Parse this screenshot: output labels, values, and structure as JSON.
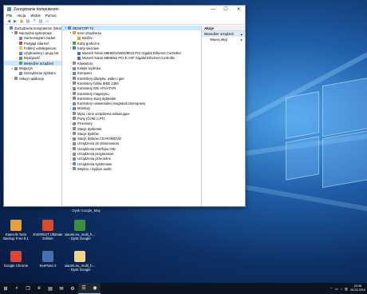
{
  "window": {
    "title": "Zarządzanie komputerem",
    "minimize": "—",
    "maximize": "☐",
    "close": "✕"
  },
  "menu": [
    "Plik",
    "Akcja",
    "Widok",
    "Pomoc"
  ],
  "left_tree": [
    {
      "label": "Zarządzanie komputerem (lokal",
      "indent": 0,
      "exp": "",
      "color": "#5a8ccc"
    },
    {
      "label": "Narzędzia systemowe",
      "indent": 1,
      "exp": "▾",
      "color": "#8a8a8a"
    },
    {
      "label": "Harmonogram zadań",
      "indent": 2,
      "exp": "›",
      "color": "#6d8fb8"
    },
    {
      "label": "Podgląd zdarzeń",
      "indent": 2,
      "exp": "›",
      "color": "#c0504d"
    },
    {
      "label": "Foldery udostępnione",
      "indent": 2,
      "exp": "›",
      "color": "#e8c05a"
    },
    {
      "label": "Użytkownicy i grupy lok",
      "indent": 2,
      "exp": "›",
      "color": "#5a8ccc"
    },
    {
      "label": "Wydajność",
      "indent": 2,
      "exp": "›",
      "color": "#4aa34a"
    },
    {
      "label": "Menedżer urządzeń",
      "indent": 2,
      "exp": "",
      "color": "#6a88b0",
      "selected": true
    },
    {
      "label": "Magazyn",
      "indent": 1,
      "exp": "▾",
      "color": "#8a8a8a"
    },
    {
      "label": "Zarządzanie dyskami",
      "indent": 2,
      "exp": "",
      "color": "#8a8a8a"
    },
    {
      "label": "Usługi i aplikacje",
      "indent": 1,
      "exp": "›",
      "color": "#8a8a8a"
    }
  ],
  "device_tree": [
    {
      "label": "DESKTOP-T2",
      "indent": 0,
      "exp": "▾",
      "color": "#5a8ccc",
      "selected": true
    },
    {
      "label": "Inne urządzenia",
      "indent": 1,
      "exp": "▾",
      "color": "#d9a23b"
    },
    {
      "label": "Bodźni",
      "indent": 2,
      "exp": "",
      "color": "#d9a23b"
    },
    {
      "label": "Karty graficzne",
      "indent": 1,
      "exp": "›",
      "color": "#4aa34a"
    },
    {
      "label": "Karty sieciowe",
      "indent": 1,
      "exp": "▾",
      "color": "#4a7ab8"
    },
    {
      "label": "Marvell Yukon 88E8001/8003/8010 PCI Gigabit Ethernet Controller",
      "indent": 2,
      "exp": "",
      "color": "#4a7ab8"
    },
    {
      "label": "Marvell Yukon 88E8052 PCI-E ASF Gigabit Ethernet Controller",
      "indent": 2,
      "exp": "",
      "color": "#4a7ab8"
    },
    {
      "label": "Klawiatury",
      "indent": 1,
      "exp": "›",
      "color": "#8a8a8a"
    },
    {
      "label": "Kolejki wydruku",
      "indent": 1,
      "exp": "›",
      "color": "#8a8a8a"
    },
    {
      "label": "Komputer",
      "indent": 1,
      "exp": "›",
      "color": "#5a8ccc"
    },
    {
      "label": "Kontrolery dźwięku, wideo i gier",
      "indent": 1,
      "exp": "›",
      "color": "#8a8a8a"
    },
    {
      "label": "Kontrolery hosta IEEE 1394",
      "indent": 1,
      "exp": "›",
      "color": "#8a8a8a"
    },
    {
      "label": "Kontrolery IDE ATA/ATAPI",
      "indent": 1,
      "exp": "›",
      "color": "#8a8a8a"
    },
    {
      "label": "Kontrolery magazynu",
      "indent": 1,
      "exp": "›",
      "color": "#8a8a8a"
    },
    {
      "label": "Kontrolery stacji dyskietek",
      "indent": 1,
      "exp": "›",
      "color": "#8a8a8a"
    },
    {
      "label": "Kontrolery uniwersalnej magistrali szeregowej",
      "indent": 1,
      "exp": "›",
      "color": "#8a8a8a"
    },
    {
      "label": "Monitory",
      "indent": 1,
      "exp": "›",
      "color": "#5a8ccc"
    },
    {
      "label": "Mysz i inne urządzenia wskazujące",
      "indent": 1,
      "exp": "›",
      "color": "#8a8a8a"
    },
    {
      "label": "Porty (COM i LPT)",
      "indent": 1,
      "exp": "›",
      "color": "#8a8a8a"
    },
    {
      "label": "Procesory",
      "indent": 1,
      "exp": "›",
      "color": "#8a8a8a"
    },
    {
      "label": "Stacje dyskietek",
      "indent": 1,
      "exp": "›",
      "color": "#8a8a8a"
    },
    {
      "label": "Stacje dysków",
      "indent": 1,
      "exp": "›",
      "color": "#8a8a8a"
    },
    {
      "label": "Stacje dysków CD-ROM/DVD",
      "indent": 1,
      "exp": "›",
      "color": "#8a8a8a"
    },
    {
      "label": "Urządzenia do obrazowania",
      "indent": 1,
      "exp": "›",
      "color": "#8a8a8a"
    },
    {
      "label": "Urządzenia interfejsu HID",
      "indent": 1,
      "exp": "›",
      "color": "#8a8a8a"
    },
    {
      "label": "Urządzenia programowe",
      "indent": 1,
      "exp": "›",
      "color": "#8a8a8a"
    },
    {
      "label": "Urządzenia przenośne",
      "indent": 1,
      "exp": "›",
      "color": "#8a8a8a"
    },
    {
      "label": "Urządzenia systemowe",
      "indent": 1,
      "exp": "›",
      "color": "#5a8ccc"
    },
    {
      "label": "Wejście i wyjście audio",
      "indent": 1,
      "exp": "›",
      "color": "#8a8a8a"
    }
  ],
  "actions": {
    "header": "Akcje",
    "section": "Menedżer urządzeń",
    "more": "Więcej akcji",
    "arrow_up": "▴",
    "arrow_right": "▸"
  },
  "desktop_icons": [
    {
      "label": "EaseUS Todo Backup Free 8.1",
      "color": "#e8a13a"
    },
    {
      "label": "EVEREST Ultimate Edition",
      "color": "#d94c2b"
    },
    {
      "label": "xiaomi.eu_multi_h... - Dysk Google",
      "color": "#3d8f3d"
    },
    {
      "label": "Google Chrome",
      "color": "#db4437"
    },
    {
      "label": "KeePass 2",
      "color": "#4a6fb0"
    },
    {
      "label": "xiaomi.eu_multi_h... - Dysk Google",
      "color": "#f1d38a"
    }
  ],
  "desktop_partial_text": "- Dysk Google_May",
  "taskbar": {
    "start": "⊞",
    "search": "⌕",
    "taskview": "❐",
    "items": [
      "e",
      "▤",
      "✉",
      "⚙",
      "☰",
      "◉"
    ],
    "tray_icons": [
      "⌃",
      "▭",
      "♪",
      "▥"
    ],
    "time": "22:46",
    "date": "26.04.2016"
  }
}
